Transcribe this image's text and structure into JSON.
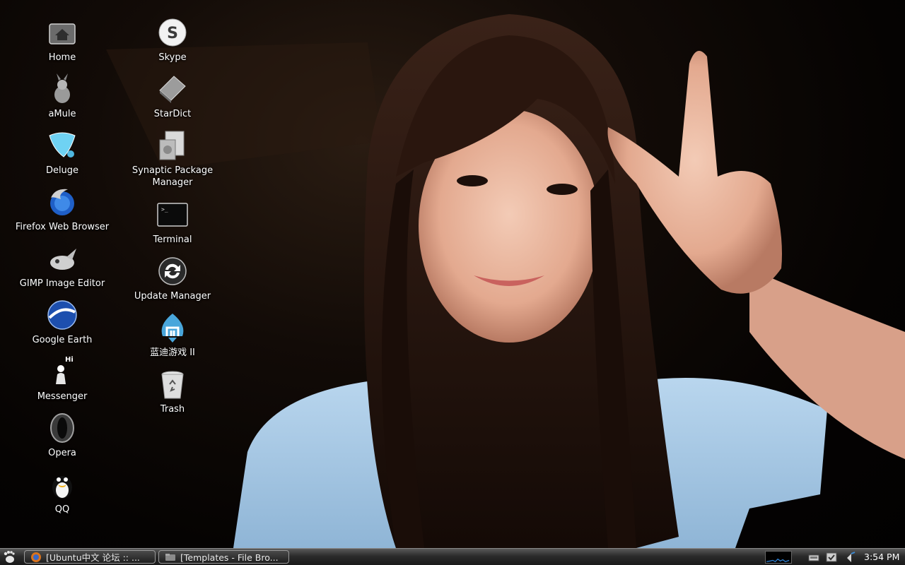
{
  "desktop_icons": {
    "column1": [
      {
        "id": "home",
        "label": "Home",
        "icon": "home-folder-icon"
      },
      {
        "id": "amule",
        "label": "aMule",
        "icon": "amule-icon"
      },
      {
        "id": "deluge",
        "label": "Deluge",
        "icon": "deluge-icon"
      },
      {
        "id": "firefox",
        "label": "Firefox Web Browser",
        "icon": "firefox-icon"
      },
      {
        "id": "gimp",
        "label": "GIMP Image Editor",
        "icon": "gimp-icon"
      },
      {
        "id": "google-earth",
        "label": "Google Earth",
        "icon": "google-earth-icon"
      },
      {
        "id": "messenger",
        "label": "Messenger",
        "icon": "messenger-icon"
      },
      {
        "id": "opera",
        "label": "Opera",
        "icon": "opera-icon"
      },
      {
        "id": "qq",
        "label": "QQ",
        "icon": "qq-penguin-icon"
      }
    ],
    "column2": [
      {
        "id": "skype",
        "label": "Skype",
        "icon": "skype-icon"
      },
      {
        "id": "stardict",
        "label": "StarDict",
        "icon": "stardict-icon"
      },
      {
        "id": "synaptic",
        "label": "Synaptic Package Manager",
        "icon": "synaptic-icon"
      },
      {
        "id": "terminal",
        "label": "Terminal",
        "icon": "terminal-icon"
      },
      {
        "id": "update-manager",
        "label": "Update Manager",
        "icon": "update-manager-icon"
      },
      {
        "id": "landi-games",
        "label": "蓝迪游戏 II",
        "icon": "landi-games-icon"
      },
      {
        "id": "trash",
        "label": "Trash",
        "icon": "trash-icon"
      }
    ]
  },
  "messenger_badge": "Hi",
  "taskbar": {
    "start_icon": "gnome-foot-icon",
    "tasks": [
      {
        "label": "[Ubuntu中文 论坛 :: ...",
        "icon": "firefox-icon"
      },
      {
        "label": "[Templates - File Bro...",
        "icon": "file-browser-icon"
      }
    ],
    "tray": [
      "system-monitor-icon",
      "network-icon",
      "updates-icon",
      "volume-icon"
    ],
    "clock": "3:54 PM"
  },
  "colors": {
    "taskbar_top": "#5a5a5a",
    "taskbar_bottom": "#1a1a1a",
    "label_text": "#ffffff",
    "wallpaper_shirt": "#a9cbe6"
  }
}
